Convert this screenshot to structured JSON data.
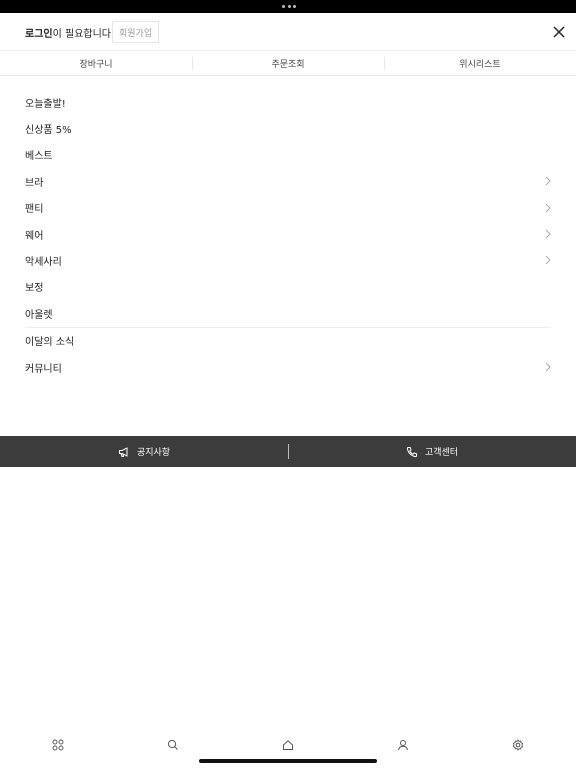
{
  "header": {
    "login_bold": "로그인",
    "login_rest": "이 필요합니다",
    "join_label": "회원가입"
  },
  "quick_tabs": [
    "장바구니",
    "주문조회",
    "위시리스트"
  ],
  "menu": [
    {
      "label": "오늘출발!",
      "has_children": false
    },
    {
      "label": "신상품 5%",
      "has_children": false
    },
    {
      "label": "베스트",
      "has_children": false
    },
    {
      "label": "브라",
      "has_children": true
    },
    {
      "label": "팬티",
      "has_children": true
    },
    {
      "label": "웨어",
      "has_children": true
    },
    {
      "label": "악세사리",
      "has_children": true
    },
    {
      "label": "보정",
      "has_children": false
    },
    {
      "label": "아울렛",
      "has_children": false
    },
    {
      "label": "이달의 소식",
      "has_children": false
    },
    {
      "label": "커뮤니티",
      "has_children": true
    }
  ],
  "info_bar": {
    "notice_label": "공지사항",
    "support_label": "고객센터"
  },
  "tab_bar": {
    "icons": [
      "grid-icon",
      "search-icon",
      "home-icon",
      "user-icon",
      "settings-icon"
    ]
  },
  "colors": {
    "info_bar_bg": "#3c3c3c",
    "status_bar_bg": "#000000"
  }
}
